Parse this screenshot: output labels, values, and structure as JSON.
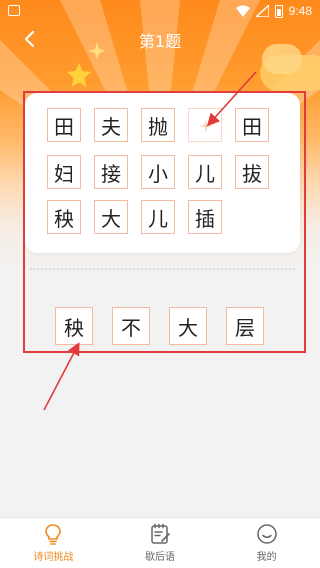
{
  "status_bar": {
    "time": "9:48"
  },
  "header": {
    "title": "第1题"
  },
  "grid": {
    "rows": [
      [
        "田",
        "夫",
        "抛",
        "",
        "田"
      ],
      [
        "妇",
        "接",
        "小",
        "儿",
        "拔"
      ],
      [
        "秧",
        "大",
        "儿",
        "插"
      ]
    ]
  },
  "answers": [
    "秧",
    "不",
    "大",
    "层"
  ],
  "tabs": [
    {
      "label": "诗词挑战",
      "icon": "lightbulb-icon",
      "active": true
    },
    {
      "label": "歇后语",
      "icon": "notepad-icon",
      "active": false
    },
    {
      "label": "我的",
      "icon": "smiley-icon",
      "active": false
    }
  ],
  "colors": {
    "accent": "#f08a20",
    "header": "#ff8a1c",
    "annotation": "#e23b3b",
    "cell_border": "#f3b9a1"
  }
}
